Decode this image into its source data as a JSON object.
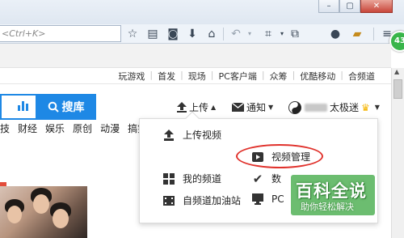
{
  "browser": {
    "url_placeholder": "<Ctrl+K>",
    "badge": "43",
    "window_controls": [
      "–",
      "▢",
      "✕"
    ]
  },
  "topnav": {
    "items": [
      "玩游戏",
      "首发",
      "现场",
      "PC客户端",
      "众筹",
      "优酷移动",
      "合频道"
    ]
  },
  "search": {
    "button_label": "搜库"
  },
  "header": {
    "upload_label": "上传",
    "notify_label": "通知",
    "username": "太极迷"
  },
  "categories": [
    "技",
    "财经",
    "娱乐",
    "原创",
    "动漫",
    "搞笑"
  ],
  "dropdown": {
    "items": [
      {
        "label": "上传视频",
        "icon": "upload-icon"
      },
      {
        "label": "视频管理",
        "icon": "play-icon"
      },
      {
        "label": "我的频道",
        "icon": "grid-icon"
      },
      {
        "label": "数",
        "icon": "check-icon"
      },
      {
        "label": "自频道加油站",
        "icon": "film-icon"
      },
      {
        "label": "PC",
        "icon": "monitor-icon"
      }
    ]
  },
  "watermark": {
    "title": "百科全说",
    "subtitle": "助你轻松解决"
  },
  "colors": {
    "accent": "#1e88e5",
    "highlight": "#e0312b",
    "watermark": "#4caf50"
  }
}
